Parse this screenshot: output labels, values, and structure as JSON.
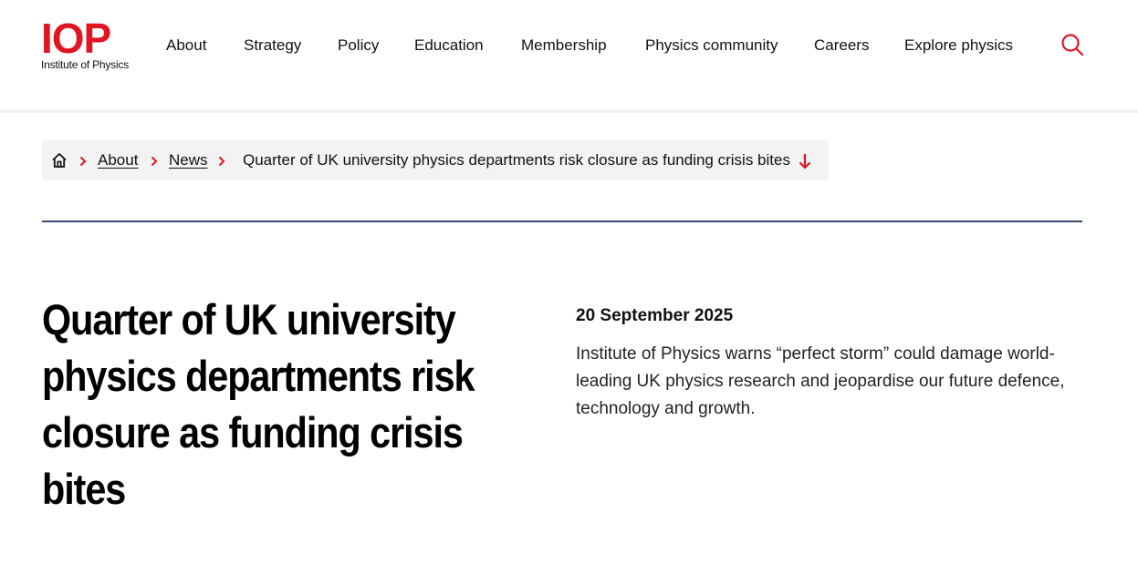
{
  "brand": {
    "logo_mark": "IOP",
    "logo_text": "Institute of Physics",
    "accent_color": "#e11522"
  },
  "nav": {
    "items": [
      {
        "label": "About"
      },
      {
        "label": "Strategy"
      },
      {
        "label": "Policy"
      },
      {
        "label": "Education"
      },
      {
        "label": "Membership"
      },
      {
        "label": "Physics community"
      },
      {
        "label": "Careers"
      },
      {
        "label": "Explore physics"
      }
    ],
    "search_icon": "search-icon"
  },
  "breadcrumb": {
    "home_icon": "home-icon",
    "items": [
      {
        "label": "About"
      },
      {
        "label": "News"
      }
    ],
    "current": "Quarter of UK university physics departments risk closure as funding crisis bites",
    "arrow_icon": "arrow-down-icon"
  },
  "article": {
    "title": "Quarter of UK university physics departments risk closure as funding crisis bites",
    "date": "20 September 2025",
    "standfirst": "Institute of Physics warns “perfect storm” could damage world-leading UK physics research and jeopardise our future defence, technology and growth."
  },
  "colors": {
    "rule": "#3c4a72",
    "breadcrumb_bg": "#f3f3f3"
  }
}
